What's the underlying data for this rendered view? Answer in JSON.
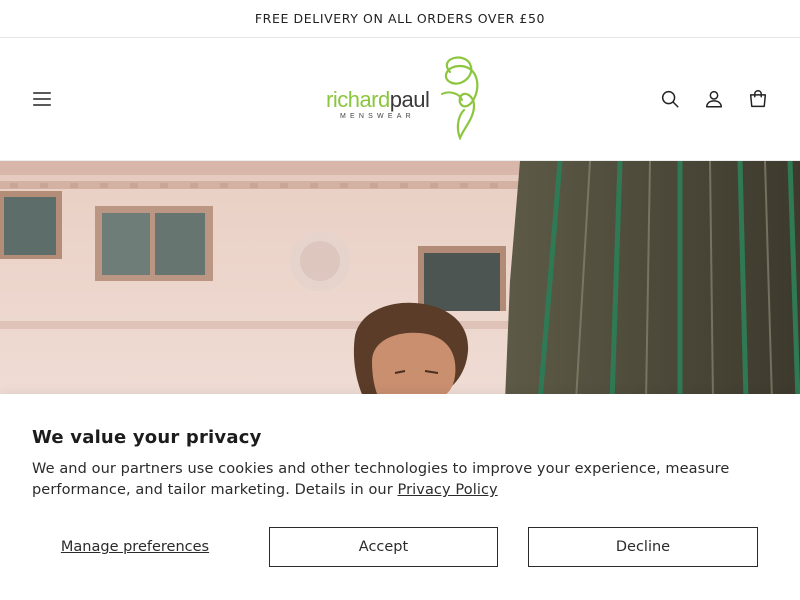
{
  "announcement": {
    "text": "FREE DELIVERY ON ALL ORDERS OVER £50"
  },
  "header": {
    "logo": {
      "word1": "richard",
      "word2": "paul",
      "tagline": "MENSWEAR"
    },
    "icons": [
      "menu-icon",
      "search-icon",
      "account-icon",
      "cart-icon"
    ]
  },
  "hero": {
    "image": "man-outdoors-building-fence-photo"
  },
  "cookie": {
    "title": "We value your privacy",
    "text": "We and our partners use cookies and other technologies to improve your experience, measure performance, and tailor marketing. Details in our ",
    "policy_link": "Privacy Policy",
    "manage_label": "Manage preferences",
    "accept_label": "Accept",
    "decline_label": "Decline"
  },
  "colors": {
    "brand_green": "#8cc63f",
    "text": "#2b2b2b",
    "border": "#e6e6e6"
  }
}
